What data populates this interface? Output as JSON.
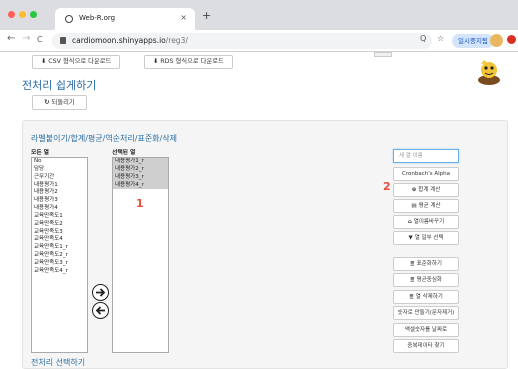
{
  "browser": {
    "tab_title": "Web-R.org",
    "tab_close": "×",
    "new_tab": "+",
    "nav_back": "←",
    "nav_forward": "→",
    "nav_reload": "C",
    "url_host": "cardiomoon.shinyapps.io",
    "url_path": "/reg3/",
    "zoom_icon": "Q",
    "star_icon": "☆",
    "profile_label": "일시중지됨"
  },
  "toolbar": {
    "csv_download": "CSV 형식으로 다운로드",
    "rds_download": "RDS 형식으로 다운로드",
    "download_icon": "⬇"
  },
  "page": {
    "title": "전처리 쉽게하기",
    "reset_label": "되돌리기",
    "reset_icon": "↻"
  },
  "section": {
    "title": "라벨붙이기/합계/평균/역순처리/표준화/삭제",
    "bottom_title": "전처리 선택하기"
  },
  "all_columns": {
    "label": "모든 열",
    "items": [
      "No",
      "담당",
      "근무기간",
      "내용평가1",
      "내용평가2",
      "내용평가3",
      "내용평가4",
      "교육만족도1",
      "교육만족도2",
      "교육만족도3",
      "교육만족도4",
      "교육만족도1_r",
      "교육만족도2_r",
      "교육만족도3_r",
      "교육만족도4_r"
    ]
  },
  "selected_columns": {
    "label": "선택된 열",
    "items": [
      "내용평가1_r",
      "내용평가2_r",
      "내용평가3_r",
      "내용평가4_r"
    ]
  },
  "annotations": {
    "one": "1",
    "two": "2"
  },
  "actions": {
    "new_col_placeholder": "새 열 이름",
    "cronbach": "Cronbach's Alpha",
    "sum": "합계 계산",
    "sum_icon": "⊕",
    "mean": "평균 계산",
    "mean_icon": "▤",
    "relabel": "열이름바꾸기",
    "relabel_icon": "⌂",
    "select_cols": "열 일부 선택",
    "select_icon": "▼",
    "standardize": "표준화하기",
    "center": "평균중심화",
    "delete": "열 삭제하기",
    "grid_icon": "≣",
    "to_numeric": "숫자로 만들기(문자제거)",
    "missing_to_na": "액셀숫자를 날짜로",
    "find_dup": "중복데이타 찾기"
  },
  "colors": {
    "heading_blue": "#2a6da3",
    "annotation_red": "#e74c3c",
    "selection_gray": "#cfcfcf"
  }
}
